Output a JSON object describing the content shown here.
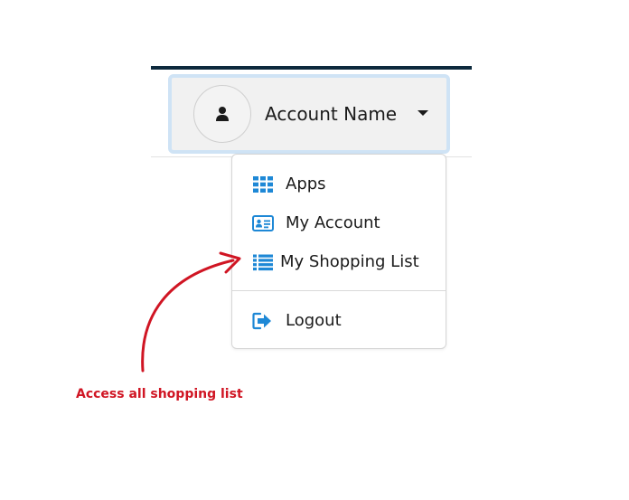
{
  "account": {
    "name": "Account Name",
    "avatar_icon": "user-icon"
  },
  "menu": {
    "items": [
      {
        "label": "Apps",
        "icon": "grid-icon"
      },
      {
        "label": "My Account",
        "icon": "id-card-icon"
      },
      {
        "label": "My Shopping List",
        "icon": "list-icon"
      },
      {
        "label": "Logout",
        "icon": "logout-icon"
      }
    ]
  },
  "annotation": {
    "text": "Access all shopping list"
  },
  "colors": {
    "accent_blue": "#1e88d6",
    "annotation_red": "#d01523",
    "header_bar": "#0d2a3d",
    "focus_ring": "#cfe3f5"
  }
}
